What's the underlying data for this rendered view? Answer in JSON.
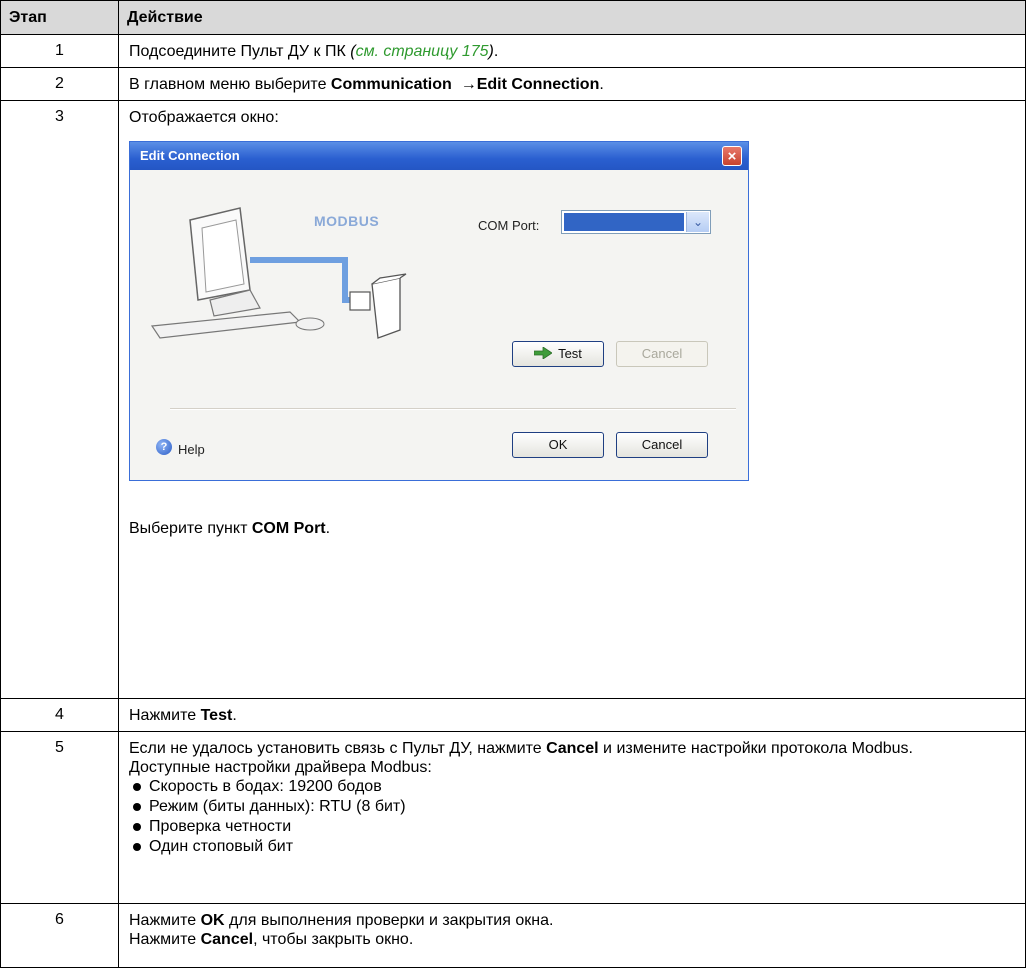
{
  "header": {
    "step_col": "Этап",
    "action_col": "Действие"
  },
  "rows": [
    {
      "num": "1",
      "text": "Подсоедините Пульт ДУ к ПК ",
      "link_open": "(",
      "link": "см. страницу 175",
      "link_close": ")",
      "tail": "."
    },
    {
      "num": "2",
      "pre": "В главном меню выберите ",
      "b1": "Communication",
      "arrow": "→",
      "b2": "Edit Connection",
      "tail": "."
    },
    {
      "num": "3",
      "intro": "Отображается окно:",
      "pre": "Выберите пункт ",
      "bold": "COM Port",
      "tail": "."
    },
    {
      "num": "4",
      "pre": "Нажмите ",
      "bold": "Test",
      "tail": "."
    },
    {
      "num": "5",
      "pre": "Если не удалось установить связь с Пульт ДУ, нажмите ",
      "bold": "Cancel",
      "mid": " и измените настройки протокола Modbus.",
      "line2": "Доступные настройки драйвера Modbus:",
      "bullets": [
        "Скорость в бодах: 19200 бодов",
        "Режим (биты данных): RTU (8 бит)",
        "Проверка четности",
        "Один стоповый бит"
      ]
    },
    {
      "num": "6",
      "pre1": "Нажмите ",
      "bold1": "OK",
      "tail1": " для выполнения проверки и закрытия окна.",
      "pre2": "Нажмите ",
      "bold2": "Cancel",
      "tail2": ", чтобы закрыть окно."
    }
  ],
  "dialog": {
    "title": "Edit Connection",
    "close": "×",
    "diagram_label": "MODBUS",
    "com_label": "COM Port:",
    "test_btn": "Test",
    "cancel_disabled": "Cancel",
    "ok_btn": "OK",
    "cancel_btn": "Cancel",
    "help_icon": "?",
    "help_label": "Help",
    "colors": {
      "title_bar": "#2a5fd0",
      "select_fill": "#3165c5",
      "link": "#2f9a2f"
    }
  }
}
